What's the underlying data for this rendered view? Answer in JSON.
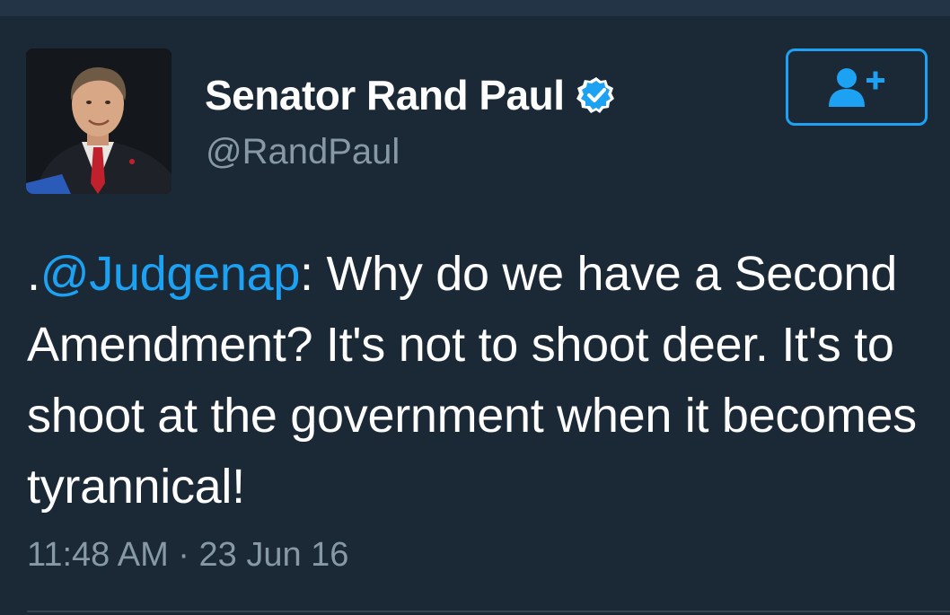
{
  "tweet": {
    "user": {
      "display_name": "Senator Rand Paul",
      "handle": "@RandPaul",
      "verified": true,
      "avatar_icon": "profile-photo"
    },
    "follow_button": {
      "icon": "add-user-icon"
    },
    "text": {
      "prefix": ".",
      "mention": "@Judgenap",
      "body": ": Why do we have a Second Amendment? It's not to shoot deer. It's to shoot at the government when it becomes tyrannical!"
    },
    "timestamp": "11:48 AM · 23 Jun 16"
  },
  "colors": {
    "background": "#1b2836",
    "accent": "#1da1f2",
    "secondary_text": "#8899a6"
  }
}
